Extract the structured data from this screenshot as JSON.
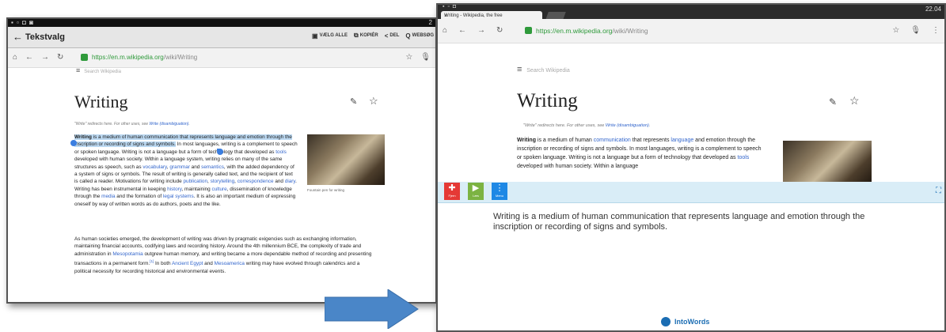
{
  "left": {
    "sys_time": "2",
    "action_title": "Tekstvalg",
    "actions": [
      {
        "icon": "select-all-icon",
        "label": "VÆLG ALLE"
      },
      {
        "icon": "copy-icon",
        "label": "KOPIÉR"
      },
      {
        "icon": "share-icon",
        "label": "DEL"
      },
      {
        "icon": "search-icon",
        "label": "WEBSØG"
      }
    ],
    "url_host": "https://en.m.wikipedia.org",
    "url_path": "/wiki/Writing",
    "search_placeholder": "Search Wikipedia",
    "page_title": "Writing",
    "redirect_prefix": "\"Write\" redirects here. For other uses, see ",
    "redirect_link": "Write (disambiguation)",
    "redirect_suffix": ".",
    "image_caption": "Fountain pen for writing",
    "para1": [
      {
        "t": "Writing",
        "b": true,
        "hl": true
      },
      {
        "t": " is a medium of human communication that represents language and emotion",
        "hl": true
      },
      {
        "t": " through the inscription or recording of signs and symbols.",
        "hl": true
      },
      {
        "t": " In most languages, writing is a complement to speech or spoken language. Writing is not a language but a form of technology that developed as "
      },
      {
        "t": "tools",
        "a": true
      },
      {
        "t": " developed with human society. Within a language system, writing relies on many of the same structures as speech, such as "
      },
      {
        "t": "vocabulary",
        "a": true
      },
      {
        "t": ", "
      },
      {
        "t": "grammar",
        "a": true
      },
      {
        "t": " and "
      },
      {
        "t": "semantics",
        "a": true
      },
      {
        "t": ", with the added dependency of a system of signs or symbols. The result of writing is generally called text, and the recipient of text is called a reader. Motivations for writing include "
      },
      {
        "t": "publication",
        "a": true
      },
      {
        "t": ", "
      },
      {
        "t": "storytelling",
        "a": true
      },
      {
        "t": ", "
      },
      {
        "t": "correspondence",
        "a": true
      },
      {
        "t": " and "
      },
      {
        "t": "diary",
        "a": true
      },
      {
        "t": ". Writing has been instrumental in keeping "
      },
      {
        "t": "history",
        "a": true
      },
      {
        "t": ", maintaining "
      },
      {
        "t": "culture",
        "a": true
      },
      {
        "t": ", dissemination of knowledge through the "
      },
      {
        "t": "media",
        "a": true
      },
      {
        "t": " and the formation of "
      },
      {
        "t": "legal systems",
        "a": true
      },
      {
        "t": ". It is also an important medium of expressing oneself by way of written words as do authors, poets and the like."
      }
    ],
    "para2": [
      {
        "t": "As human societies emerged, the development of writing was driven by pragmatic exigencies such as exchanging information, maintaining financial accounts, codifying laws and recording history. Around the 4th millennium BCE, the complexity of trade and administration in "
      },
      {
        "t": "Mesopotamia",
        "a": true
      },
      {
        "t": " outgrew human memory, and writing became a more dependable method of recording and presenting transactions in a permanent form."
      },
      {
        "t": "[1]",
        "a": true,
        "sup": true
      },
      {
        "t": " In both "
      },
      {
        "t": "Ancient Egypt",
        "a": true
      },
      {
        "t": " and "
      },
      {
        "t": "Mesoamerica",
        "a": true
      },
      {
        "t": " writing may have evolved through calendrics and a political necessity for recording historical and environmental events."
      }
    ]
  },
  "right": {
    "sys_time": "22.04",
    "tab_title": "Writing - Wikipedia, the free",
    "url_host": "https://en.m.wikipedia.org",
    "url_path": "/wiki/Writing",
    "search_placeholder": "Search Wikipedia",
    "page_title": "Writing",
    "redirect_prefix": "\"Write\" redirects here. For other uses, see ",
    "redirect_link": "Write (disambiguation)",
    "redirect_suffix": ".",
    "para1": [
      {
        "t": "Writing",
        "b": true
      },
      {
        "t": " is a medium of human "
      },
      {
        "t": "communication",
        "a": true
      },
      {
        "t": " that represents "
      },
      {
        "t": "language",
        "a": true
      },
      {
        "t": " and emotion through the inscription or recording of signs and symbols. In most languages, writing is a complement to speech or spoken language. Writing is not a language but a form of technology that developed as "
      },
      {
        "t": "tools",
        "a": true
      },
      {
        "t": " developed with human society. Within a language"
      }
    ],
    "toolbar": [
      {
        "icon": "clear-icon",
        "label": "Fjern",
        "color": "#e53935"
      },
      {
        "icon": "play-icon",
        "label": "Læs",
        "color": "#7cb342"
      },
      {
        "icon": "menu-icon",
        "label": "Menu",
        "color": "#1e88e5"
      }
    ],
    "selected_text": "Writing is a medium of human communication that represents language and emotion through the inscription or recording of signs and symbols.",
    "brand": "IntoWords"
  },
  "colors": {
    "accent": "#1b6db3",
    "arrow": "#4a86c8",
    "link": "#3366cc",
    "highlight": "#bcd9f2"
  }
}
